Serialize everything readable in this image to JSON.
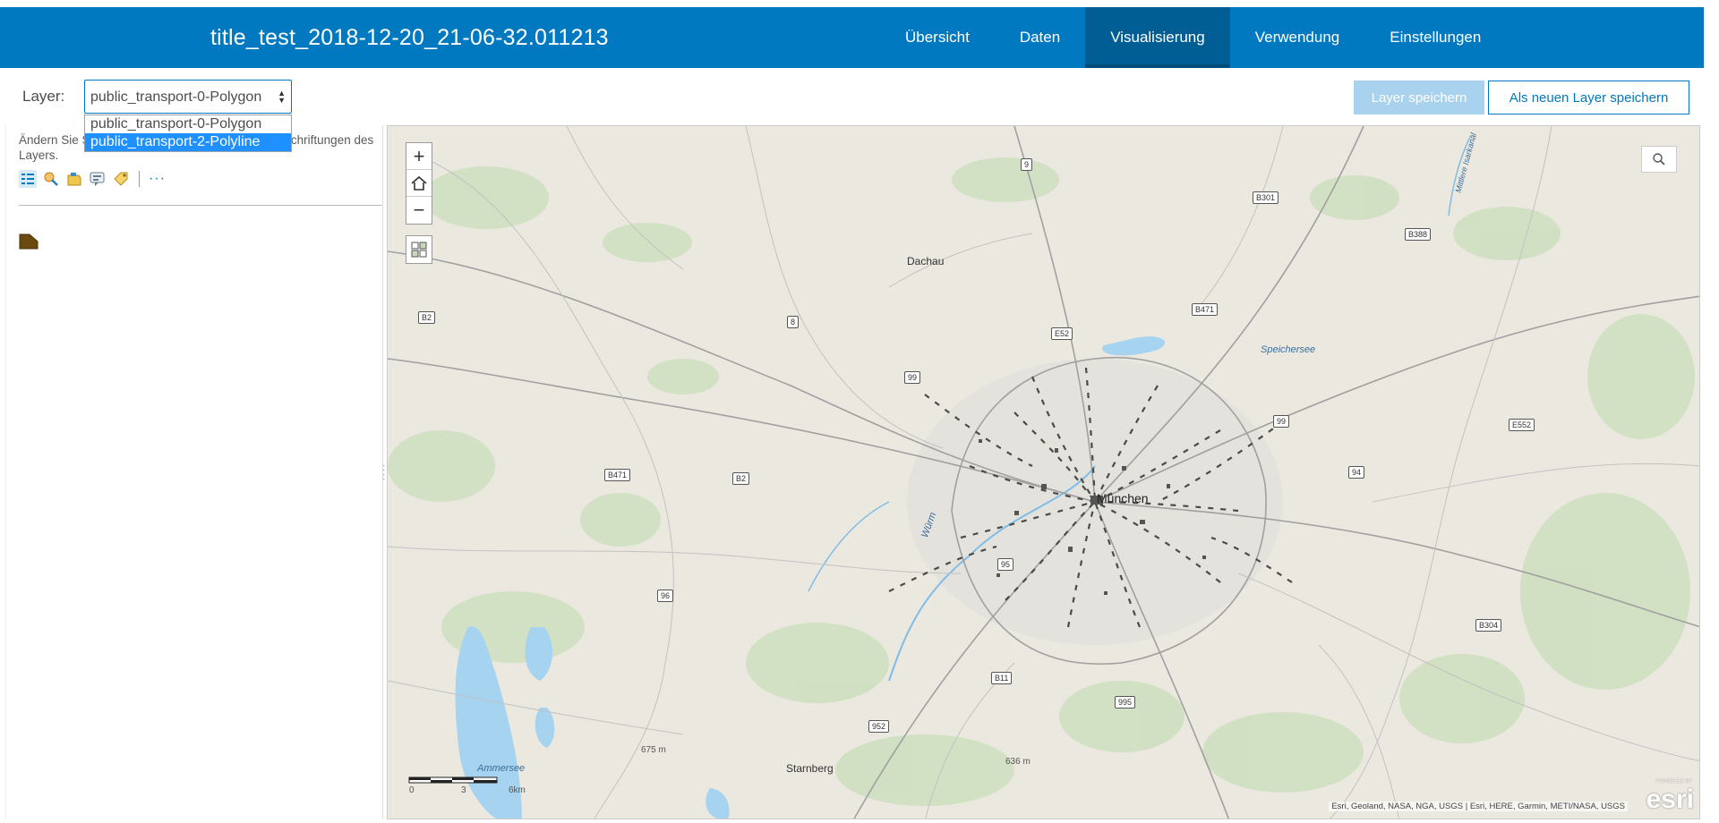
{
  "header": {
    "title": "title_test_2018-12-20_21-06-32.011213",
    "tabs": [
      {
        "label": "Übersicht",
        "active": false
      },
      {
        "label": "Daten",
        "active": false
      },
      {
        "label": "Visualisierung",
        "active": true
      },
      {
        "label": "Verwendung",
        "active": false
      },
      {
        "label": "Einstellungen",
        "active": false
      }
    ]
  },
  "layer_bar": {
    "label": "Layer:",
    "selected": "public_transport-0-Polygon",
    "options": [
      "public_transport-0-Polygon",
      "public_transport-2-Polyline"
    ],
    "highlighted_option": "public_transport-2-Polyline",
    "save_button": "Layer speichern",
    "save_new_button": "Als neuen Layer speichern"
  },
  "side_panel": {
    "description": "Ändern Sie Stil, Filter, Felder, Pop-ups und die Beschriftungen des Layers.",
    "tool_icons": [
      "style-icon",
      "filter-icon",
      "fields-icon",
      "popup-icon",
      "labels-icon"
    ],
    "more": "···",
    "legend_swatch_color": "#6b4a0f"
  },
  "map": {
    "places": {
      "munich": "München",
      "dachau": "Dachau",
      "starnberg": "Starnberg",
      "speichersee": "Speichersee",
      "ammersee": "Ammersee",
      "wurm": "Würm",
      "mittlere_isar": "Mittlere Isarkanal"
    },
    "elevations": [
      "675 m",
      "636 m"
    ],
    "road_shields": {
      "r9": "9",
      "b301": "B301",
      "b388": "B388",
      "b2_west": "B2",
      "r8": "8",
      "e52": "E52",
      "b471_north": "B471",
      "r99_west": "99",
      "r99_east": "99",
      "e552": "E552",
      "b471_west": "B471",
      "b2_mid": "B2",
      "r94": "94",
      "r95": "95",
      "r96": "96",
      "b304": "B304",
      "b11": "B11",
      "r995": "995",
      "r952": "952"
    },
    "scale": {
      "tick0": "0",
      "tick1": "3",
      "tick2": "6km"
    },
    "attribution": "Esri, Geoland, NASA, NGA, USGS | Esri, HERE, Garmin, METI/NASA, USGS",
    "logo": "esri",
    "powered_by": "POWERED BY",
    "colors": {
      "background": "#ebe8e0",
      "water": "#a6d3ef",
      "green": "#cfdfc0",
      "road": "#9a9a9a",
      "transit": "#444444"
    }
  }
}
